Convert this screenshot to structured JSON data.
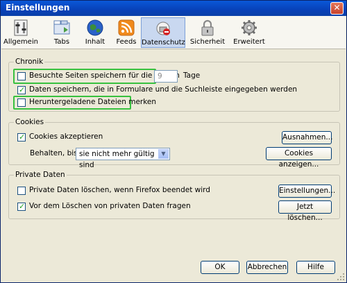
{
  "window": {
    "title": "Einstellungen",
    "close_glyph": "✕"
  },
  "toolbar": {
    "tabs": [
      {
        "label": "Allgemein",
        "icon": "switches-icon"
      },
      {
        "label": "Tabs",
        "icon": "tabs-icon"
      },
      {
        "label": "Inhalt",
        "icon": "globe-icon"
      },
      {
        "label": "Feeds",
        "icon": "rss-feed-icon"
      },
      {
        "label": "Datenschutz",
        "icon": "privacy-mask-icon",
        "selected": true
      },
      {
        "label": "Sicherheit",
        "icon": "padlock-icon"
      },
      {
        "label": "Erweitert",
        "icon": "gear-icon"
      }
    ]
  },
  "chronik": {
    "legend": "Chronik",
    "visited_label": "Besuchte Seiten speichern für die letzten",
    "visited_checked": false,
    "days_value": "9",
    "days_unit": "Tage",
    "formdata_label": "Daten speichern, die in Formulare und die Suchleiste eingegeben werden",
    "formdata_checked": true,
    "downloads_label": "Heruntergeladene Dateien merken",
    "downloads_checked": false
  },
  "cookies": {
    "legend": "Cookies",
    "accept_label": "Cookies akzeptieren",
    "accept_checked": true,
    "exceptions_button": "Ausnahmen...",
    "keep_label": "Behalten, bis:",
    "keep_value": "sie nicht mehr gültig sind",
    "show_button": "Cookies anzeigen..."
  },
  "private": {
    "legend": "Private Daten",
    "clear_on_exit_label": "Private Daten löschen, wenn Firefox beendet wird",
    "clear_on_exit_checked": false,
    "settings_button": "Einstellungen...",
    "ask_label": "Vor dem Löschen von privaten Daten fragen",
    "ask_checked": true,
    "clear_now_button": "Jetzt löschen..."
  },
  "footer": {
    "ok": "OK",
    "cancel": "Abbrechen",
    "help": "Hilfe"
  },
  "colors": {
    "title_bar": "#0a4fcf",
    "highlight": "#38c13f",
    "selected_tab": "#c9d8f0"
  }
}
